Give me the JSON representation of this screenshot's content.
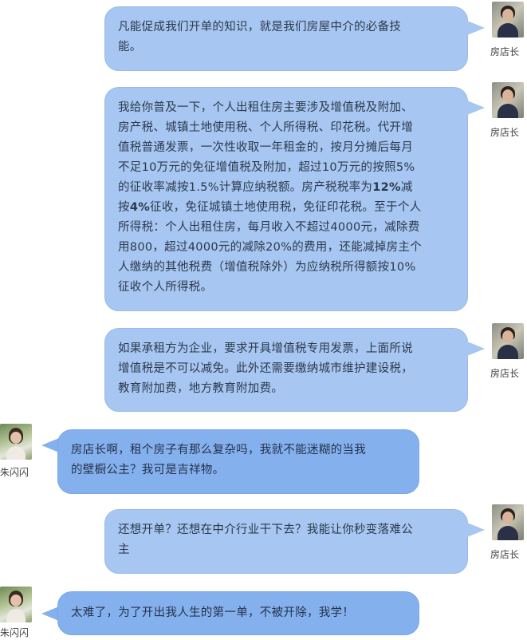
{
  "speakers": {
    "agent": "房店长",
    "customer": "朱闪闪"
  },
  "messages": [
    {
      "from": "agent",
      "avatar_icon": "agent-avatar-photo",
      "name": "房店长",
      "lines": [
        "凡能促成我们开单的知识，就是我们房屋中介的必备技",
        "能。"
      ]
    },
    {
      "from": "agent",
      "avatar_icon": "agent-avatar-photo",
      "name": "房店长",
      "lines": [
        "我给你普及一下，个人出租住房主要涉及增值税及附加、",
        "房产税、城镇土地使用税、个人所得税、印花税。代开增",
        "值税普通发票，一次性收取一年租金的，按月分摊后每月",
        "不足10万元的免征增值税及附加，超过10万元的按照5%",
        "的征收率减按1.5%计算应纳税额。房产税税率为",
        "12%",
        "减",
        "按",
        "4%",
        "征收，免征城镇土地使用税，免征印花税。至于个人",
        "所得税：个人出租住房，每月收入不超过4000元，减除费",
        "用800，超过4000元的减除20%的费用，还能减掉房主个",
        "人缴纳的其他税费（增值税除外）为应纳税所得额按10%",
        "征收个人所得税。"
      ]
    },
    {
      "from": "agent",
      "avatar_icon": "agent-avatar-photo",
      "name": "房店长",
      "lines": [
        "如果承租方为企业，要求开具增值税专用发票，上面所说",
        "增值税是不可以减免。此外还需要缴纳城市维护建设税，",
        "教育附加费，地方教育附加费。"
      ]
    },
    {
      "from": "customer",
      "avatar_icon": "customer-avatar-photo",
      "name": "朱闪闪",
      "lines": [
        "房店长啊，租个房子有那么复杂吗，我就不能迷糊的当我",
        "的壁橱公主？我可是吉祥物。"
      ]
    },
    {
      "from": "agent",
      "avatar_icon": "agent-avatar-photo",
      "name": "房店长",
      "lines": [
        "还想开单？还想在中介行业干下去？我能让你秒变落难公",
        "主"
      ]
    },
    {
      "from": "customer",
      "avatar_icon": "customer-avatar-photo",
      "name": "朱闪闪",
      "lines": [
        "太难了，为了开出我人生的第一单，不被开除，我学！"
      ]
    }
  ],
  "colors": {
    "agent_bubble": "#a7c6f1",
    "customer_bubble": "#84b1ee",
    "text": "#2b3a4d",
    "background": "#ffffff"
  }
}
